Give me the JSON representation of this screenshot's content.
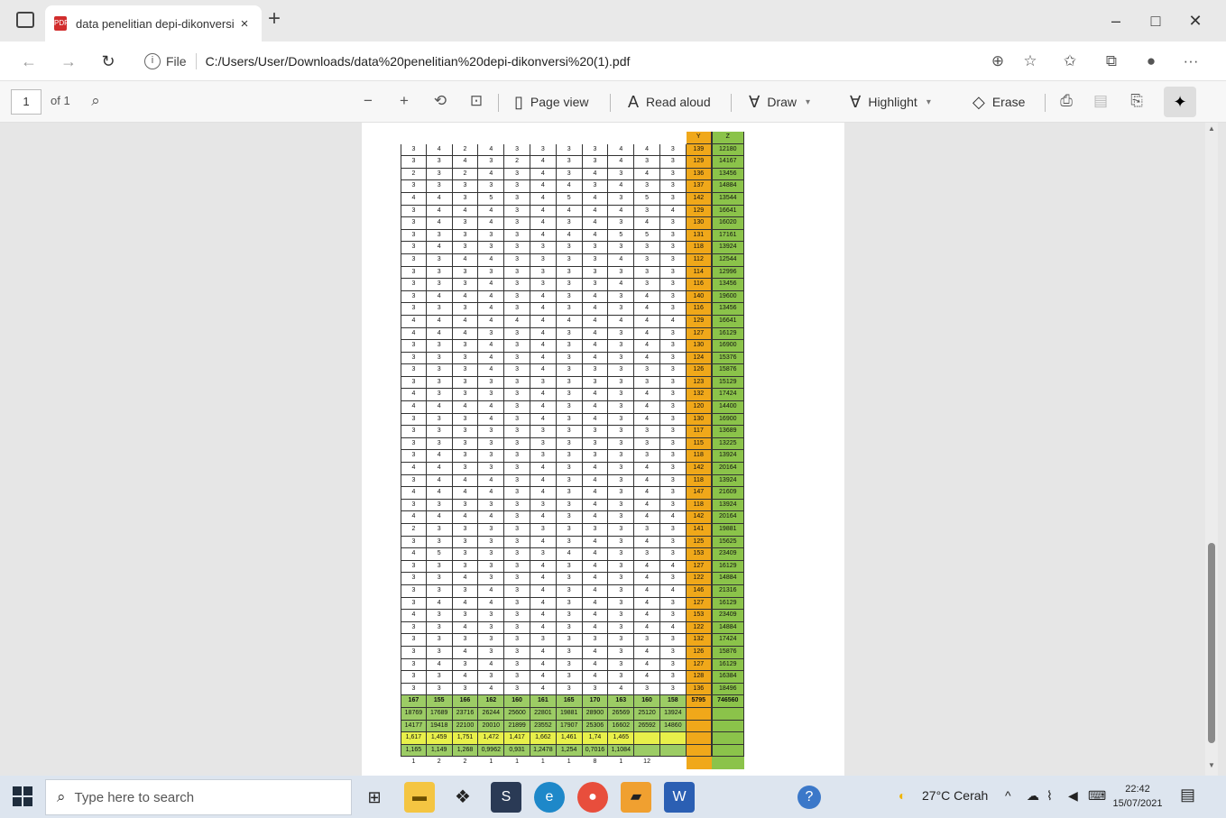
{
  "browser": {
    "tab_title": "data penelitian depi-dikonversi",
    "tab_close": "×",
    "new_tab": "+",
    "url_scheme": "File",
    "url_path": "C:/Users/User/Downloads/data%20penelitian%20depi-dikonversi%20(1).pdf",
    "minimize": "–",
    "maximize": "□",
    "close": "✕"
  },
  "pdf_toolbar": {
    "page_current": "1",
    "page_count": "of 1",
    "page_view": "Page view",
    "read_aloud": "Read aloud",
    "draw": "Draw",
    "highlight": "Highlight",
    "erase": "Erase"
  },
  "sheet": {
    "header_y": "Y",
    "header_z": "Z",
    "rows": [
      [
        "3",
        "4",
        "2",
        "4",
        "3",
        "3",
        "3",
        "3",
        "4",
        "4",
        "3",
        "139",
        "12180"
      ],
      [
        "3",
        "3",
        "4",
        "3",
        "2",
        "4",
        "3",
        "3",
        "4",
        "3",
        "3",
        "129",
        "14167"
      ],
      [
        "2",
        "3",
        "2",
        "4",
        "3",
        "4",
        "3",
        "4",
        "3",
        "4",
        "3",
        "136",
        "13456"
      ],
      [
        "3",
        "3",
        "3",
        "3",
        "3",
        "4",
        "4",
        "3",
        "4",
        "3",
        "3",
        "137",
        "14884"
      ],
      [
        "4",
        "4",
        "3",
        "5",
        "3",
        "4",
        "5",
        "4",
        "3",
        "5",
        "3",
        "142",
        "13544"
      ],
      [
        "3",
        "4",
        "4",
        "4",
        "3",
        "4",
        "4",
        "4",
        "4",
        "3",
        "4",
        "129",
        "16641"
      ],
      [
        "3",
        "4",
        "3",
        "4",
        "3",
        "4",
        "3",
        "4",
        "3",
        "4",
        "3",
        "130",
        "16020"
      ],
      [
        "3",
        "3",
        "3",
        "3",
        "3",
        "4",
        "4",
        "4",
        "5",
        "5",
        "3",
        "131",
        "17161"
      ],
      [
        "3",
        "4",
        "3",
        "3",
        "3",
        "3",
        "3",
        "3",
        "3",
        "3",
        "3",
        "118",
        "13924"
      ],
      [
        "3",
        "3",
        "4",
        "4",
        "3",
        "3",
        "3",
        "3",
        "4",
        "3",
        "3",
        "112",
        "12544"
      ],
      [
        "3",
        "3",
        "3",
        "3",
        "3",
        "3",
        "3",
        "3",
        "3",
        "3",
        "3",
        "114",
        "12996"
      ],
      [
        "3",
        "3",
        "3",
        "4",
        "3",
        "3",
        "3",
        "3",
        "4",
        "3",
        "3",
        "116",
        "13456"
      ],
      [
        "3",
        "4",
        "4",
        "4",
        "3",
        "4",
        "3",
        "4",
        "3",
        "4",
        "3",
        "140",
        "19600"
      ],
      [
        "3",
        "3",
        "3",
        "4",
        "3",
        "4",
        "3",
        "4",
        "3",
        "4",
        "3",
        "116",
        "13456"
      ],
      [
        "4",
        "4",
        "4",
        "4",
        "4",
        "4",
        "4",
        "4",
        "4",
        "4",
        "4",
        "129",
        "16641"
      ],
      [
        "4",
        "4",
        "4",
        "3",
        "3",
        "4",
        "3",
        "4",
        "3",
        "4",
        "3",
        "127",
        "16129"
      ],
      [
        "3",
        "3",
        "3",
        "4",
        "3",
        "4",
        "3",
        "4",
        "3",
        "4",
        "3",
        "130",
        "16900"
      ],
      [
        "3",
        "3",
        "3",
        "4",
        "3",
        "4",
        "3",
        "4",
        "3",
        "4",
        "3",
        "124",
        "15376"
      ],
      [
        "3",
        "3",
        "3",
        "4",
        "3",
        "4",
        "3",
        "3",
        "3",
        "3",
        "3",
        "126",
        "15876"
      ],
      [
        "3",
        "3",
        "3",
        "3",
        "3",
        "3",
        "3",
        "3",
        "3",
        "3",
        "3",
        "123",
        "15129"
      ],
      [
        "4",
        "3",
        "3",
        "3",
        "3",
        "4",
        "3",
        "4",
        "3",
        "4",
        "3",
        "132",
        "17424"
      ],
      [
        "4",
        "4",
        "4",
        "4",
        "3",
        "4",
        "3",
        "4",
        "3",
        "4",
        "3",
        "120",
        "14400"
      ],
      [
        "3",
        "3",
        "3",
        "4",
        "3",
        "4",
        "3",
        "4",
        "3",
        "4",
        "3",
        "130",
        "16900"
      ],
      [
        "3",
        "3",
        "3",
        "3",
        "3",
        "3",
        "3",
        "3",
        "3",
        "3",
        "3",
        "117",
        "13689"
      ],
      [
        "3",
        "3",
        "3",
        "3",
        "3",
        "3",
        "3",
        "3",
        "3",
        "3",
        "3",
        "115",
        "13225"
      ],
      [
        "3",
        "4",
        "3",
        "3",
        "3",
        "3",
        "3",
        "3",
        "3",
        "3",
        "3",
        "118",
        "13924"
      ],
      [
        "4",
        "4",
        "3",
        "3",
        "3",
        "4",
        "3",
        "4",
        "3",
        "4",
        "3",
        "142",
        "20164"
      ],
      [
        "3",
        "4",
        "4",
        "4",
        "3",
        "4",
        "3",
        "4",
        "3",
        "4",
        "3",
        "118",
        "13924"
      ],
      [
        "4",
        "4",
        "4",
        "4",
        "3",
        "4",
        "3",
        "4",
        "3",
        "4",
        "3",
        "147",
        "21609"
      ],
      [
        "3",
        "3",
        "3",
        "3",
        "3",
        "3",
        "3",
        "4",
        "3",
        "4",
        "3",
        "118",
        "13924"
      ],
      [
        "4",
        "4",
        "4",
        "4",
        "3",
        "4",
        "3",
        "4",
        "3",
        "4",
        "4",
        "142",
        "20164"
      ],
      [
        "2",
        "3",
        "3",
        "3",
        "3",
        "3",
        "3",
        "3",
        "3",
        "3",
        "3",
        "141",
        "19881"
      ],
      [
        "3",
        "3",
        "3",
        "3",
        "3",
        "4",
        "3",
        "4",
        "3",
        "4",
        "3",
        "125",
        "15625"
      ],
      [
        "4",
        "5",
        "3",
        "3",
        "3",
        "3",
        "4",
        "4",
        "3",
        "3",
        "3",
        "153",
        "23409"
      ],
      [
        "3",
        "3",
        "3",
        "3",
        "3",
        "4",
        "3",
        "4",
        "3",
        "4",
        "4",
        "127",
        "16129"
      ],
      [
        "3",
        "3",
        "4",
        "3",
        "3",
        "4",
        "3",
        "4",
        "3",
        "4",
        "3",
        "122",
        "14884"
      ],
      [
        "3",
        "3",
        "3",
        "4",
        "3",
        "4",
        "3",
        "4",
        "3",
        "4",
        "4",
        "146",
        "21316"
      ],
      [
        "3",
        "4",
        "4",
        "4",
        "3",
        "4",
        "3",
        "4",
        "3",
        "4",
        "3",
        "127",
        "16129"
      ],
      [
        "4",
        "3",
        "3",
        "3",
        "3",
        "4",
        "3",
        "4",
        "3",
        "4",
        "3",
        "153",
        "23409"
      ],
      [
        "3",
        "3",
        "4",
        "3",
        "3",
        "4",
        "3",
        "4",
        "3",
        "4",
        "4",
        "122",
        "14884"
      ],
      [
        "3",
        "3",
        "3",
        "3",
        "3",
        "3",
        "3",
        "3",
        "3",
        "3",
        "3",
        "132",
        "17424"
      ],
      [
        "3",
        "3",
        "4",
        "3",
        "3",
        "4",
        "3",
        "4",
        "3",
        "4",
        "3",
        "126",
        "15876"
      ],
      [
        "3",
        "4",
        "3",
        "4",
        "3",
        "4",
        "3",
        "4",
        "3",
        "4",
        "3",
        "127",
        "16129"
      ],
      [
        "3",
        "3",
        "4",
        "3",
        "3",
        "4",
        "3",
        "4",
        "3",
        "4",
        "3",
        "128",
        "16384"
      ],
      [
        "3",
        "3",
        "3",
        "4",
        "3",
        "4",
        "3",
        "3",
        "4",
        "3",
        "3",
        "136",
        "18496"
      ]
    ],
    "sum_row": [
      "167",
      "155",
      "166",
      "162",
      "160",
      "161",
      "165",
      "170",
      "163",
      "160",
      "158",
      "5795",
      "746560"
    ],
    "sum_row2": [
      "18769",
      "17689",
      "23716",
      "26244",
      "25600",
      "22801",
      "19881",
      "28900",
      "26569",
      "25120",
      "13924",
      "",
      ""
    ],
    "sum_row3": [
      "14177",
      "19418",
      "22100",
      "20010",
      "21899",
      "23552",
      "17907",
      "25306",
      "16602",
      "26592",
      "14860",
      "",
      ""
    ],
    "sum_row4": [
      "1,617",
      "1,459",
      "1,751",
      "1,472",
      "1,417",
      "1,662",
      "1,461",
      "1,74",
      "1,465",
      "",
      "",
      "",
      ""
    ],
    "sum_row5": [
      "1,165",
      "1,149",
      "1,268",
      "0,9962",
      "0,931",
      "1,2478",
      "1,254",
      "0,7016",
      "1,1084",
      "",
      "",
      "",
      ""
    ],
    "labels_row": [
      "1",
      "2",
      "2",
      "1",
      "1",
      "1",
      "1",
      "8",
      "1",
      "12",
      "",
      "",
      ""
    ]
  },
  "taskbar": {
    "search_placeholder": "Type here to search",
    "weather": "27°C  Cerah",
    "time": "22:42",
    "date": "15/07/2021"
  }
}
